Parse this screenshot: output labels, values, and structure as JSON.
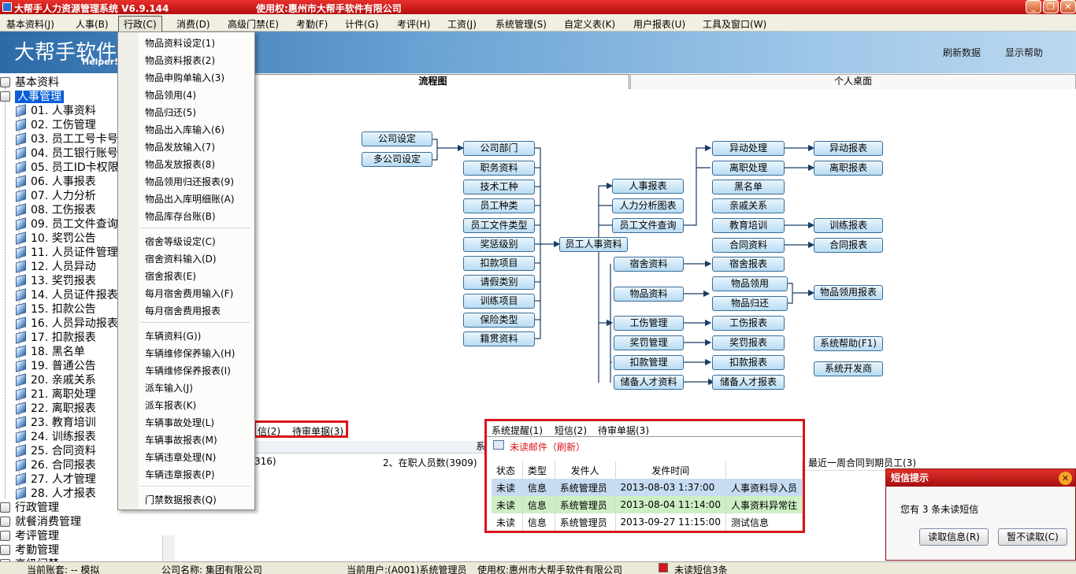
{
  "window": {
    "title": "大帮手人力资源管理系统 V6.9.144",
    "license": "使用权:惠州市大帮手软件有限公司"
  },
  "menubar": [
    "基本资料(J)",
    "人事(B)",
    "行政(C)",
    "消费(D)",
    "高级门禁(E)",
    "考勤(F)",
    "计件(G)",
    "考评(H)",
    "工资(J)",
    "系统管理(S)",
    "自定义表(K)",
    "用户报表(U)",
    "工具及窗口(W)"
  ],
  "banner": {
    "logo": "大帮手软件",
    "sub": "HelperS",
    "refresh": "刷新数据",
    "help": "显示帮助"
  },
  "dropdown": [
    "物品资料设定(1)",
    "物品资料报表(2)",
    "物品申购单输入(3)",
    "物品领用(4)",
    "物品归还(5)",
    "物品出入库输入(6)",
    "物品发放输入(7)",
    "物品发放报表(8)",
    "物品领用归还报表(9)",
    "物品出入库明细账(A)",
    "物品库存台账(B)",
    "宿舍等级设定(C)",
    "宿舍资料输入(D)",
    "宿舍报表(E)",
    "每月宿舍费用输入(F)",
    "每月宿舍费用报表",
    "车辆资料(G))",
    "车辆维修保养输入(H)",
    "车辆维修保养报表(I)",
    "派车输入(J)",
    "派车报表(K)",
    "车辆事故处理(L)",
    "车辆事故报表(M)",
    "车辆违章处理(N)",
    "车辆违章报表(P)",
    "门禁数据报表(Q)"
  ],
  "tree": {
    "root1": "基本资料",
    "root2": "人事管理",
    "items": [
      "01. 人事资料",
      "02. 工伤管理",
      "03. 员工工号卡号",
      "04. 员工银行账号",
      "05. 员工ID卡权限",
      "06. 人事报表",
      "07. 人力分析",
      "08. 工伤报表",
      "09. 员工文件查询",
      "10. 奖罚公告",
      "11. 人员证件管理",
      "12. 人员异动",
      "13. 奖罚报表",
      "14. 人员证件报表",
      "15. 扣款公告",
      "16. 人员异动报表",
      "17. 扣款报表",
      "18. 黑名单",
      "19. 普通公告",
      "20. 亲戚关系",
      "21. 离职处理",
      "22. 离职报表",
      "23. 教育培训",
      "24. 训练报表",
      "25. 合同资料",
      "26. 合同报表",
      "27. 人才管理",
      "28. 人才报表"
    ],
    "roots_after": [
      "行政管理",
      "就餐消费管理",
      "考评管理",
      "考勤管理",
      "高级门禁"
    ]
  },
  "tabs": {
    "flow": "流程图",
    "desk": "个人桌面"
  },
  "flow": {
    "col0": [
      "公司设定",
      "多公司设定"
    ],
    "col1": [
      "公司部门",
      "职务资料",
      "技术工种",
      "员工种类",
      "员工文件类型",
      "奖惩级别",
      "扣款项目",
      "请假类别",
      "训练项目",
      "保险类型",
      "籍贯资料"
    ],
    "center": "员工人事资料",
    "col2a": [
      "人事报表",
      "人力分析图表",
      "员工文件查询"
    ],
    "col2b": [
      "宿舍资料",
      "物品资料",
      "工伤管理",
      "奖罚管理",
      "扣款管理",
      "储备人才资料"
    ],
    "col3a": [
      "异动处理",
      "离职处理",
      "黑名单",
      "亲戚关系",
      "教育培训",
      "合同资料"
    ],
    "col3b": [
      "宿舍报表",
      "物品领用",
      "物品归还",
      "工伤报表",
      "奖罚报表",
      "扣款报表",
      "储备人才报表"
    ],
    "col4": [
      "异动报表",
      "离职报表",
      "训练报表",
      "合同报表",
      "物品领用报表",
      "系统帮助(F1)",
      "系统开发商"
    ]
  },
  "lower_left": {
    "tabs": [
      "信(2)",
      "待审单据(3)"
    ],
    "sys_char": "系",
    "count": "316)",
    "stat1": "2、在职人员数(3909)",
    "stat2": "最近一周合同到期员工(3)"
  },
  "messages": {
    "tabs": [
      "系统提醒(1)",
      "短信(2)",
      "待审单据(3)"
    ],
    "unread_title": "未读邮件（刷新）",
    "columns": [
      "状态",
      "类型",
      "发件人",
      "发件时间",
      ""
    ],
    "rows": [
      [
        "未读",
        "信息",
        "系统管理员",
        "2013-08-03 1:37:00",
        "人事资料导入员"
      ],
      [
        "未读",
        "信息",
        "系统管理员",
        "2013-08-04 11:14:00",
        "人事资料异常往"
      ],
      [
        "未读",
        "信息",
        "系统管理员",
        "2013-09-27 11:15:00",
        "测试信息"
      ]
    ]
  },
  "popup": {
    "title": "短信提示",
    "text": "您有 3 条未读短信",
    "read": "读取信息(R)",
    "later": "暂不读取(C)"
  },
  "status": {
    "account": "当前账套: -- 模拟",
    "company": "公司名称: 集团有限公司",
    "user": "当前用户:(A001)系统管理员",
    "license": "使用权:惠州市大帮手软件有限公司",
    "unread": "未读短信3条"
  }
}
